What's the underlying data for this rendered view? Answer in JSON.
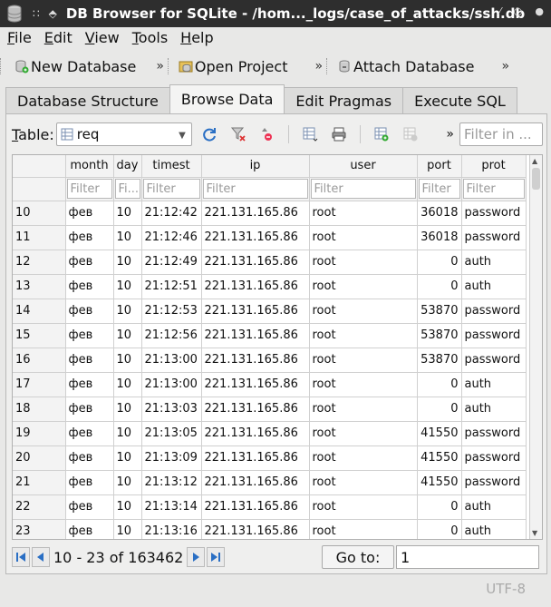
{
  "window": {
    "title": "DB Browser for SQLite - /hom..._logs/case_of_attacks/ssh.db"
  },
  "menu": [
    {
      "pre": "",
      "u": "F",
      "post": "ile"
    },
    {
      "pre": "",
      "u": "E",
      "post": "dit"
    },
    {
      "pre": "",
      "u": "V",
      "post": "iew"
    },
    {
      "pre": "",
      "u": "T",
      "post": "ools"
    },
    {
      "pre": "",
      "u": "H",
      "post": "elp"
    }
  ],
  "toolbar": {
    "new_db": "New Database",
    "open_project": "Open Project",
    "attach_db": "Attach Database",
    "overflow": "»"
  },
  "tabs": [
    "Database Structure",
    "Browse Data",
    "Edit Pragmas",
    "Execute SQL"
  ],
  "browse": {
    "table_label_pre": "",
    "table_label_u": "T",
    "table_label_post": "able:",
    "table_value": "req",
    "filter_all_placeholder": "Filter in ...",
    "overflow": "»"
  },
  "grid": {
    "columns": [
      "month",
      "day",
      "timest",
      "ip",
      "user",
      "port",
      "prot"
    ],
    "filters": [
      "Filter",
      "Fi...",
      "Filter",
      "Filter",
      "Filter",
      "Filter",
      "Filter"
    ],
    "rows": [
      {
        "n": "10",
        "c": [
          "фев",
          "10",
          "21:12:42",
          "221.131.165.86",
          "root",
          "36018",
          "password"
        ]
      },
      {
        "n": "11",
        "c": [
          "фев",
          "10",
          "21:12:46",
          "221.131.165.86",
          "root",
          "36018",
          "password"
        ]
      },
      {
        "n": "12",
        "c": [
          "фев",
          "10",
          "21:12:49",
          "221.131.165.86",
          "root",
          "0",
          "auth"
        ]
      },
      {
        "n": "13",
        "c": [
          "фев",
          "10",
          "21:12:51",
          "221.131.165.86",
          "root",
          "0",
          "auth"
        ]
      },
      {
        "n": "14",
        "c": [
          "фев",
          "10",
          "21:12:53",
          "221.131.165.86",
          "root",
          "53870",
          "password"
        ]
      },
      {
        "n": "15",
        "c": [
          "фев",
          "10",
          "21:12:56",
          "221.131.165.86",
          "root",
          "53870",
          "password"
        ]
      },
      {
        "n": "16",
        "c": [
          "фев",
          "10",
          "21:13:00",
          "221.131.165.86",
          "root",
          "53870",
          "password"
        ]
      },
      {
        "n": "17",
        "c": [
          "фев",
          "10",
          "21:13:00",
          "221.131.165.86",
          "root",
          "0",
          "auth"
        ]
      },
      {
        "n": "18",
        "c": [
          "фев",
          "10",
          "21:13:03",
          "221.131.165.86",
          "root",
          "0",
          "auth"
        ]
      },
      {
        "n": "19",
        "c": [
          "фев",
          "10",
          "21:13:05",
          "221.131.165.86",
          "root",
          "41550",
          "password"
        ]
      },
      {
        "n": "20",
        "c": [
          "фев",
          "10",
          "21:13:09",
          "221.131.165.86",
          "root",
          "41550",
          "password"
        ]
      },
      {
        "n": "21",
        "c": [
          "фев",
          "10",
          "21:13:12",
          "221.131.165.86",
          "root",
          "41550",
          "password"
        ]
      },
      {
        "n": "22",
        "c": [
          "фев",
          "10",
          "21:13:14",
          "221.131.165.86",
          "root",
          "0",
          "auth"
        ]
      },
      {
        "n": "23",
        "c": [
          "фев",
          "10",
          "21:13:16",
          "221.131.165.86",
          "root",
          "0",
          "auth"
        ]
      }
    ]
  },
  "nav": {
    "position": "10 - 23 of 163462",
    "goto_label": "Go to:",
    "goto_value": "1"
  },
  "status": {
    "encoding": "UTF-8"
  },
  "colors": {
    "titlebar": "#2e2e2e",
    "panel": "#efefee",
    "window_bg": "#e8e8e7"
  }
}
